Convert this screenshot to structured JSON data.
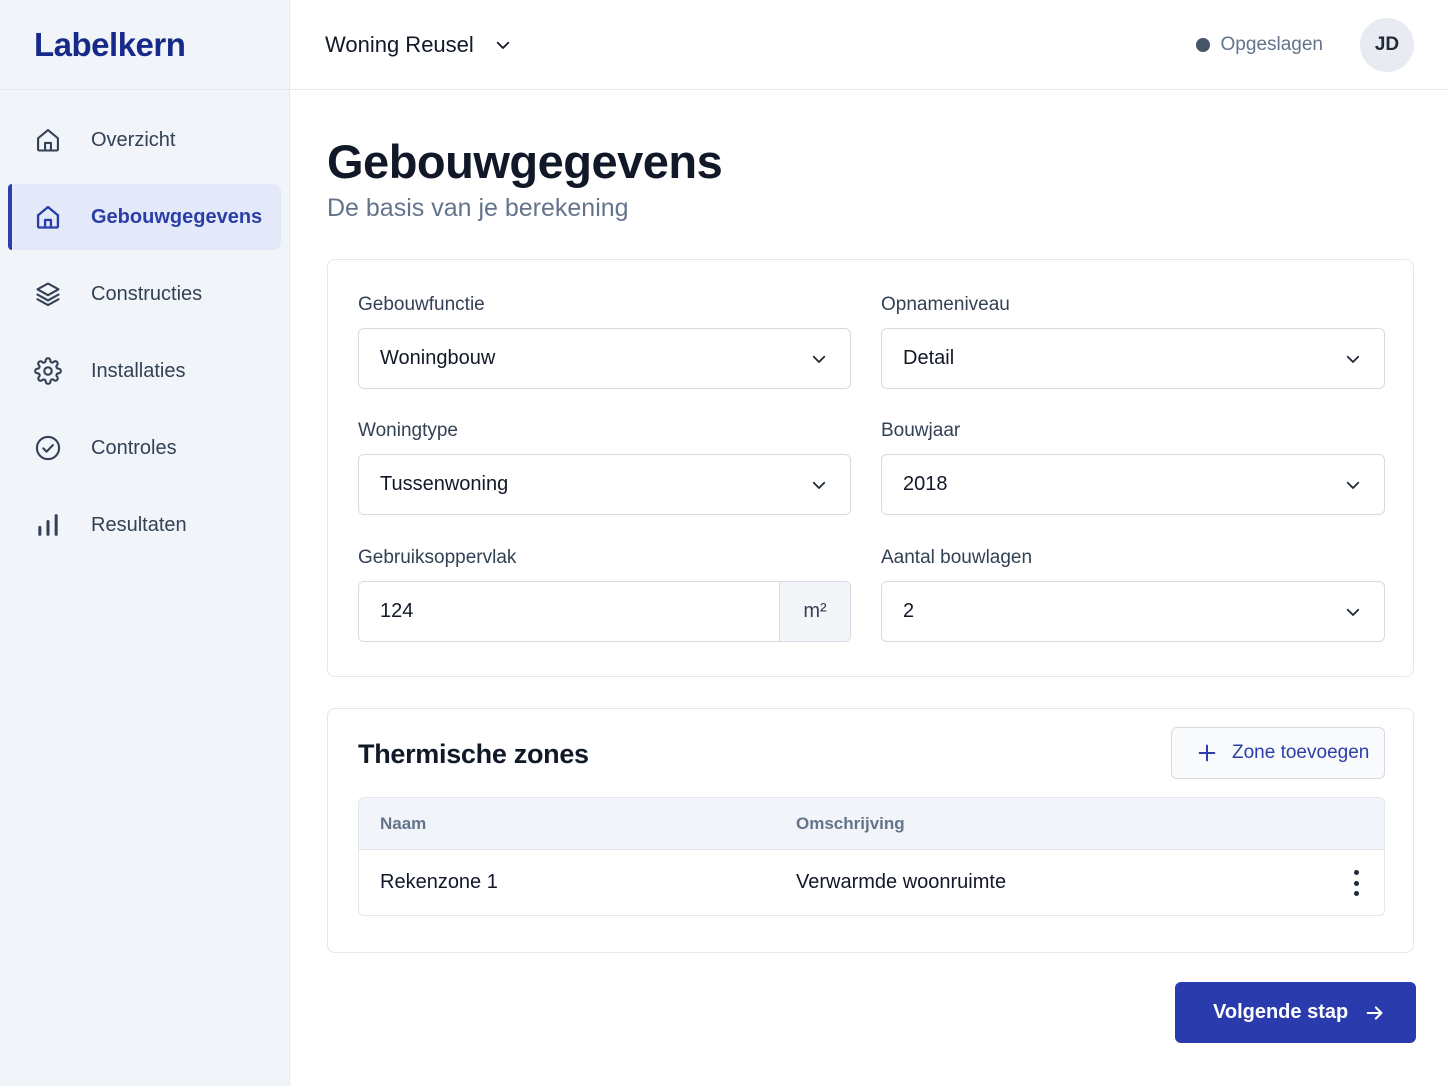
{
  "app": {
    "logo": "Labelkern"
  },
  "sidebar": {
    "items": [
      {
        "label": "Overzicht",
        "icon": "home-icon",
        "active": false
      },
      {
        "label": "Gebouwgegevens",
        "icon": "home-icon",
        "active": true
      },
      {
        "label": "Constructies",
        "icon": "layers-icon",
        "active": false
      },
      {
        "label": "Installaties",
        "icon": "gear-icon",
        "active": false
      },
      {
        "label": "Controles",
        "icon": "check-circle-icon",
        "active": false
      },
      {
        "label": "Resultaten",
        "icon": "bar-chart-icon",
        "active": false
      }
    ]
  },
  "topbar": {
    "project_name": "Woning Reusel",
    "status": "Opgeslagen",
    "avatar_initials": "JD"
  },
  "page": {
    "title": "Gebouwgegevens",
    "subtitle": "De basis van je berekening"
  },
  "form": {
    "gebouwfunctie": {
      "label": "Gebouwfunctie",
      "value": "Woningbouw"
    },
    "opnameniveau": {
      "label": "Opnameniveau",
      "value": "Detail"
    },
    "woningtype": {
      "label": "Woningtype",
      "value": "Tussenwoning"
    },
    "bouwjaar": {
      "label": "Bouwjaar",
      "value": "2018"
    },
    "gebruiksoppervlak": {
      "label": "Gebruiksoppervlak",
      "value": "124",
      "unit": "m²"
    },
    "bouwlagen": {
      "label": "Aantal bouwlagen",
      "value": "2"
    }
  },
  "zones": {
    "title": "Thermische zones",
    "add_label": "Zone toevoegen",
    "columns": [
      "Naam",
      "Omschrijving"
    ],
    "rows": [
      {
        "naam": "Rekenzone 1",
        "omschrijving": "Verwarmde woonruimte"
      }
    ]
  },
  "footer": {
    "next_label": "Volgende stap"
  },
  "colors": {
    "accent": "#2a3bae",
    "sidebar_bg": "#f1f4f9",
    "active_bg": "#e3e9f8"
  }
}
